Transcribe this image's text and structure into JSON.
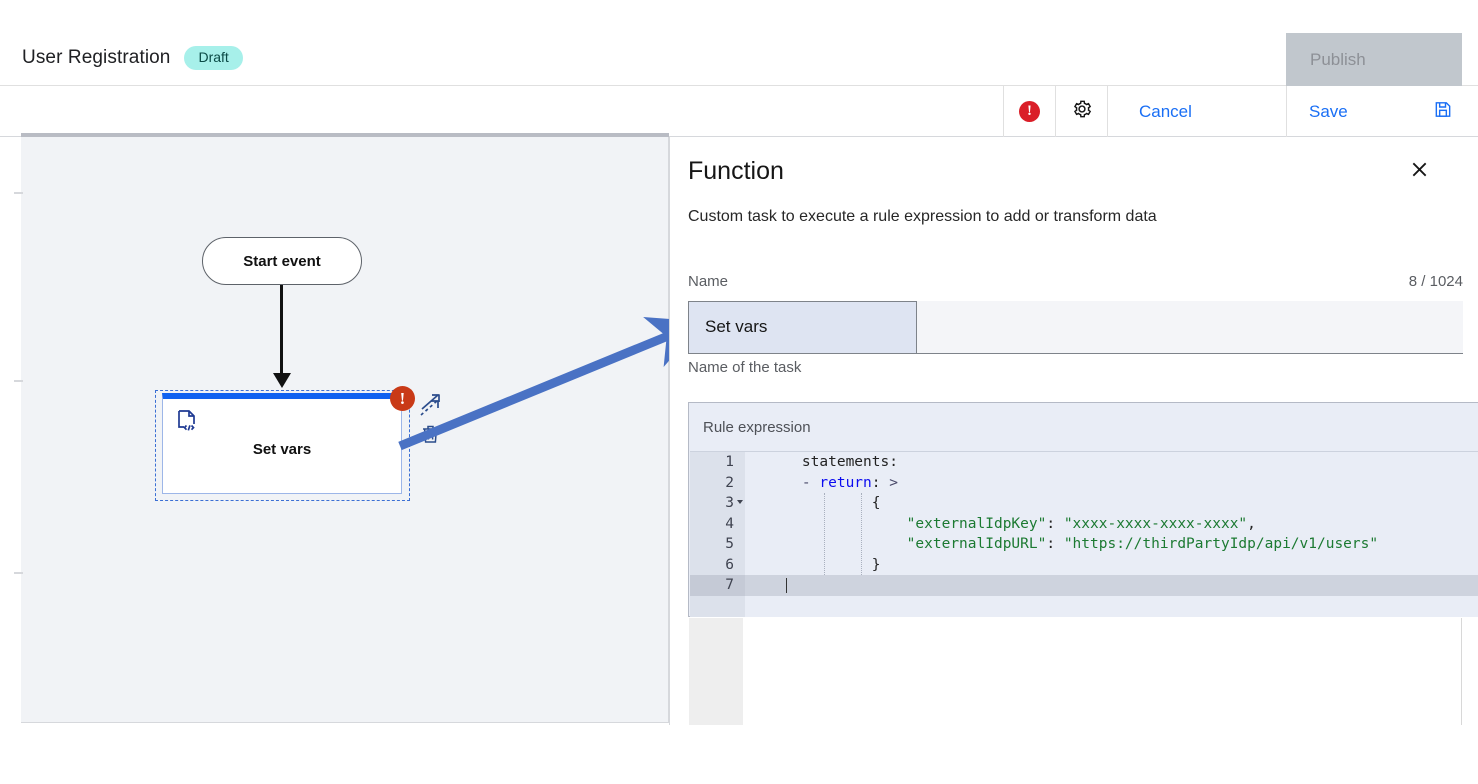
{
  "header": {
    "title": "User Registration",
    "status_tag": "Draft",
    "publish_label": "Publish"
  },
  "toolbar": {
    "error_icon": "error-exclamation-icon",
    "error_glyph": "!",
    "settings_icon": "gear-icon",
    "cancel_label": "Cancel",
    "save_label": "Save",
    "save_icon": "floppy-disk-icon",
    "accent_color": "#1a6ff5",
    "error_color": "#da1e28"
  },
  "canvas": {
    "start_node_label": "Start event",
    "task_node_label": "Set vars",
    "task_node_icon": "code-document-icon",
    "task_badge_glyph": "!",
    "task_badge_color": "#c93a17",
    "task_accent_color": "#1062f0",
    "connect_tool_icon": "connect-arrow-icon",
    "delete_tool_icon": "trash-icon",
    "annotation_arrow_color": "#4a72c4"
  },
  "panel": {
    "title": "Function",
    "close_icon": "close-icon",
    "description": "Custom task to execute a rule expression to add or transform data",
    "name_field": {
      "label": "Name",
      "counter": "8 / 1024",
      "value": "Set vars",
      "help": "Name of the task"
    },
    "rule_expression": {
      "legend": "Rule expression",
      "active_line": 7,
      "lines": [
        {
          "n": "1",
          "tokens": [
            {
              "t": "plain",
              "v": "    statements:"
            }
          ]
        },
        {
          "n": "2",
          "tokens": [
            {
              "t": "punc",
              "v": "    - "
            },
            {
              "t": "key",
              "v": "return"
            },
            {
              "t": "plain",
              "v": ":"
            },
            {
              "t": "punc",
              "v": " >"
            }
          ]
        },
        {
          "n": "3",
          "fold": true,
          "tokens": [
            {
              "t": "plain",
              "v": "            {"
            }
          ]
        },
        {
          "n": "4",
          "tokens": [
            {
              "t": "str",
              "v": "                \"externalIdpKey\""
            },
            {
              "t": "plain",
              "v": ": "
            },
            {
              "t": "str",
              "v": "\"xxxx-xxxx-xxxx-xxxx\""
            },
            {
              "t": "plain",
              "v": ","
            }
          ]
        },
        {
          "n": "5",
          "tokens": [
            {
              "t": "str",
              "v": "                \"externalIdpURL\""
            },
            {
              "t": "plain",
              "v": ": "
            },
            {
              "t": "str",
              "v": "\"https://thirdPartyIdp/api/v1/users\""
            }
          ]
        },
        {
          "n": "6",
          "tokens": [
            {
              "t": "plain",
              "v": "            }"
            }
          ]
        },
        {
          "n": "7",
          "tokens": []
        }
      ]
    }
  }
}
